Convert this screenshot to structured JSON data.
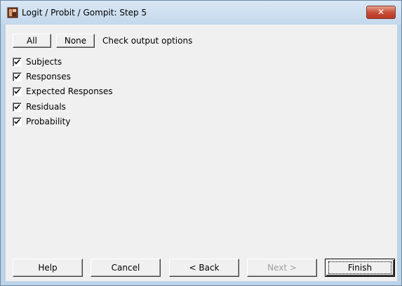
{
  "window": {
    "title": "Logit / Probit / Gompit: Step 5",
    "close_label": "✕"
  },
  "toolbar": {
    "all_label": "All",
    "none_label": "None",
    "caption": "Check output options"
  },
  "options": [
    {
      "label": "Subjects",
      "checked": true
    },
    {
      "label": "Responses",
      "checked": true
    },
    {
      "label": "Expected Responses",
      "checked": true
    },
    {
      "label": "Residuals",
      "checked": true
    },
    {
      "label": "Probability",
      "checked": true
    }
  ],
  "buttons": {
    "help": "Help",
    "cancel": "Cancel",
    "back": "< Back",
    "next": "Next >",
    "finish": "Finish"
  },
  "colors": {
    "close_button": "#c9503b",
    "client_bg": "#f0f0f0",
    "frame": "#bcd3e8"
  },
  "icons": [
    "app-icon",
    "close-icon",
    "checkmark-icon"
  ]
}
